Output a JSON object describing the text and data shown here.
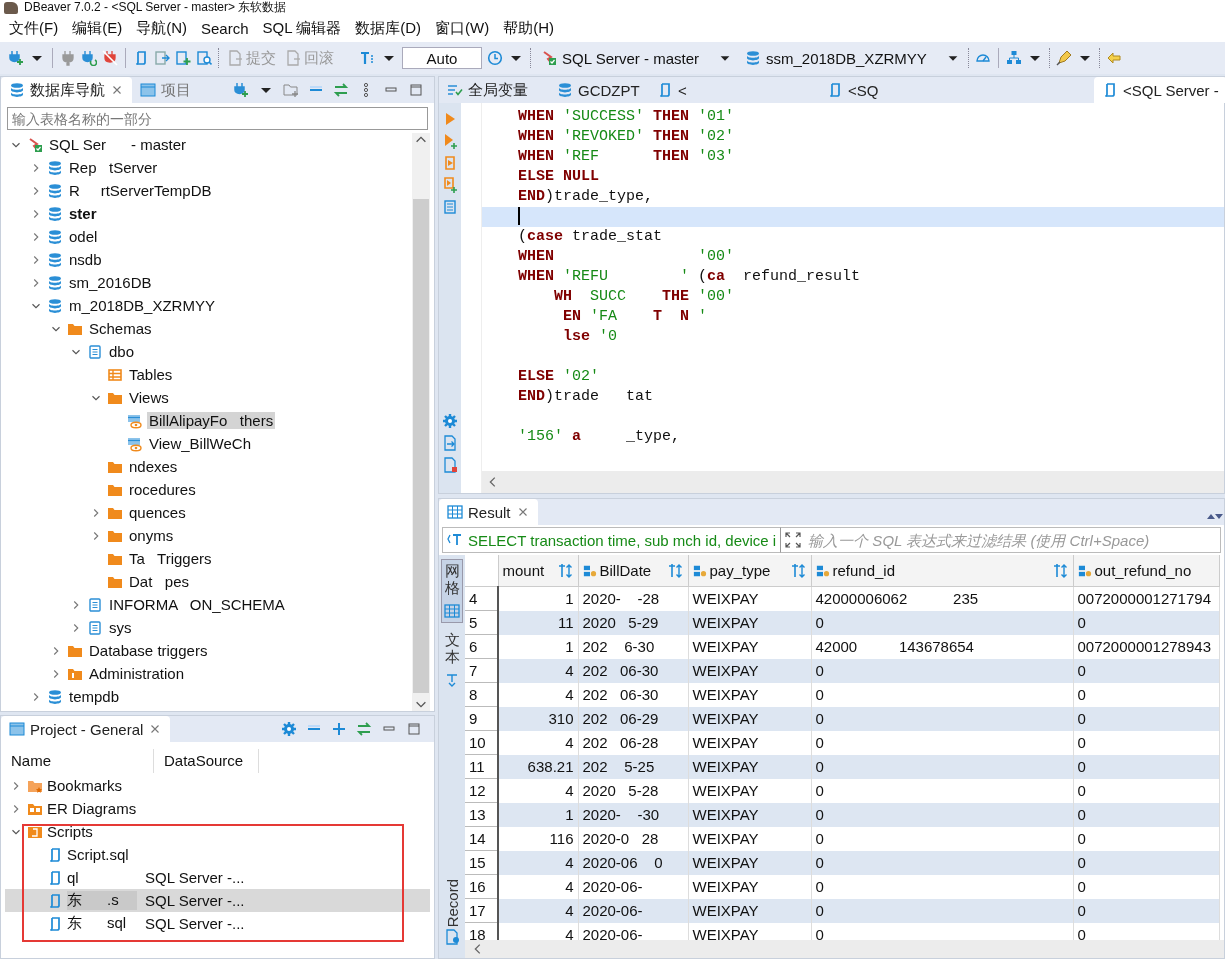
{
  "window": {
    "title": "DBeaver 7.0.2 - <SQL Server - master> 东软数据"
  },
  "menu": [
    "文件(F)",
    "编辑(E)",
    "导航(N)",
    "Search",
    "SQL 编辑器",
    "数据库(D)",
    "窗口(W)",
    "帮助(H)"
  ],
  "toolbar": {
    "commit": "提交",
    "rollback": "回滚",
    "mode": "Auto",
    "connection": "SQL Server - master",
    "database": "ssm_2018DB_XZRMYY"
  },
  "navigator": {
    "tabs": [
      {
        "label": "数据库导航",
        "selected": true
      },
      {
        "label": "项目",
        "selected": false
      }
    ],
    "filter": {
      "placeholder": "输入表格名称的一部分"
    },
    "tree": [
      {
        "label": "SQL Ser      - master",
        "kind": "connection",
        "expanded": true,
        "selected": false,
        "children": [
          {
            "label": "Rep   tServer",
            "kind": "database",
            "expanded": false,
            "selected": false,
            "default": false
          },
          {
            "label": "R     rtServerTempDB",
            "kind": "database",
            "expanded": false,
            "selected": false,
            "default": false
          },
          {
            "label": "ster",
            "kind": "database",
            "expanded": false,
            "selected": false,
            "default": true
          },
          {
            "label": "odel",
            "kind": "database",
            "expanded": false,
            "selected": false,
            "default": false
          },
          {
            "label": "nsdb",
            "kind": "database",
            "expanded": false,
            "selected": false,
            "default": false
          },
          {
            "label": "sm_2016DB",
            "kind": "database",
            "expanded": false,
            "selected": false,
            "default": false
          },
          {
            "label": "m_2018DB_XZRMYY",
            "kind": "database",
            "expanded": true,
            "selected": false,
            "default": false,
            "children": [
              {
                "label": "Schemas",
                "kind": "folder",
                "expanded": true,
                "selected": false,
                "children": [
                  {
                    "label": "dbo",
                    "kind": "schema",
                    "expanded": true,
                    "selected": false,
                    "children": [
                      {
                        "label": "Tables",
                        "kind": "tables",
                        "selected": false
                      },
                      {
                        "label": "Views",
                        "kind": "folder",
                        "expanded": true,
                        "selected": false,
                        "children": [
                          {
                            "label": "BillAlipayFo   thers",
                            "kind": "view",
                            "selected": true
                          },
                          {
                            "label": "View_BillWeCh",
                            "kind": "view",
                            "selected": false
                          }
                        ]
                      },
                      {
                        "label": "ndexes",
                        "kind": "folder",
                        "selected": false
                      },
                      {
                        "label": "rocedures",
                        "kind": "folder",
                        "selected": false
                      },
                      {
                        "label": "quences",
                        "kind": "folder",
                        "expanded": false,
                        "selected": false
                      },
                      {
                        "label": "onyms",
                        "kind": "folder",
                        "expanded": false,
                        "selected": false
                      },
                      {
                        "label": "Ta   Triggers",
                        "kind": "folder",
                        "selected": false
                      },
                      {
                        "label": "Dat   pes",
                        "kind": "folder",
                        "selected": false
                      }
                    ]
                  },
                  {
                    "label": "INFORMA   ON_SCHEMA",
                    "kind": "schema",
                    "expanded": false,
                    "selected": false
                  },
                  {
                    "label": "sys",
                    "kind": "schema",
                    "expanded": false,
                    "selected": false
                  }
                ]
              },
              {
                "label": "Database triggers",
                "kind": "folder",
                "expanded": false,
                "selected": false
              },
              {
                "label": "Administration",
                "kind": "admin",
                "expanded": false,
                "selected": false
              }
            ]
          },
          {
            "label": "tempdb",
            "kind": "database",
            "expanded": false,
            "selected": false,
            "default": false
          }
        ]
      }
    ]
  },
  "project": {
    "tab": "Project - General",
    "columns": [
      "Name",
      "DataSource"
    ],
    "tree": [
      {
        "label": "Bookmarks",
        "kind": "bookmarks",
        "expanded": false,
        "selected": false
      },
      {
        "label": "ER Diagrams",
        "kind": "diagrams",
        "expanded": false,
        "selected": false
      },
      {
        "label": "Scripts",
        "kind": "scripts",
        "expanded": true,
        "selected": false,
        "children": [
          {
            "label": "Script.sql",
            "kind": "script",
            "selected": false
          },
          {
            "label": "ql",
            "kind": "script",
            "selected": false,
            "datasource": "SQL Server -..."
          },
          {
            "label": "东      .s",
            "kind": "script",
            "selected": true,
            "datasource": "SQL Server -..."
          },
          {
            "label": "东      sql",
            "kind": "script",
            "selected": false,
            "datasource": "SQL Server -..."
          }
        ]
      }
    ]
  },
  "editor": {
    "tabs": [
      {
        "label": "全局变量",
        "kind": "variables",
        "selected": false
      },
      {
        "label": "GCDZPT",
        "kind": "database",
        "selected": false
      },
      {
        "label": "<",
        "kind": "script",
        "selected": false
      },
      {
        "label": "<SQ",
        "kind": "script",
        "selected": false
      },
      {
        "label": "<SQL Server -",
        "kind": "script",
        "selected": true
      }
    ],
    "lines": [
      {
        "current": false,
        "tokens": [
          {
            "kind": "keyword",
            "text": "WHEN"
          },
          {
            "kind": "string",
            "text": " 'SUCCESS'"
          },
          {
            "kind": "keyword",
            "text": " THEN"
          },
          {
            "kind": "string",
            "text": " '01'"
          }
        ]
      },
      {
        "current": false,
        "tokens": [
          {
            "kind": "keyword",
            "text": "WHEN"
          },
          {
            "kind": "string",
            "text": " 'REVOKED'"
          },
          {
            "kind": "keyword",
            "text": " THEN"
          },
          {
            "kind": "string",
            "text": " '02'"
          }
        ]
      },
      {
        "current": false,
        "tokens": [
          {
            "kind": "keyword",
            "text": "WHEN"
          },
          {
            "kind": "string",
            "text": " 'REF"
          },
          {
            "kind": "keyword",
            "text": "      THEN"
          },
          {
            "kind": "string",
            "text": " '03'"
          }
        ]
      },
      {
        "current": false,
        "tokens": [
          {
            "kind": "keyword",
            "text": "ELSE NULL"
          }
        ]
      },
      {
        "current": false,
        "tokens": [
          {
            "kind": "keyword",
            "text": "END"
          },
          {
            "kind": "plain",
            "text": ")trade_type,"
          }
        ]
      },
      {
        "current": true
      },
      {
        "current": false,
        "tokens": [
          {
            "kind": "plain",
            "text": "("
          },
          {
            "kind": "keyword",
            "text": "case"
          },
          {
            "kind": "plain",
            "text": " trade_stat"
          }
        ]
      },
      {
        "current": false,
        "tokens": [
          {
            "kind": "keyword",
            "text": "WHEN"
          },
          {
            "kind": "string",
            "text": "                '00'"
          }
        ]
      },
      {
        "current": false,
        "tokens": [
          {
            "kind": "keyword",
            "text": "WHEN"
          },
          {
            "kind": "string",
            "text": " 'REFU        '"
          },
          {
            "kind": "plain",
            "text": " ("
          },
          {
            "kind": "keyword",
            "text": "ca"
          },
          {
            "kind": "plain",
            "text": "  refund_result"
          }
        ]
      },
      {
        "current": false,
        "tokens": [
          {
            "kind": "keyword",
            "text": "    WH"
          },
          {
            "kind": "string",
            "text": "  SUCC"
          },
          {
            "kind": "keyword",
            "text": "    THE"
          },
          {
            "kind": "string",
            "text": " '00'"
          }
        ]
      },
      {
        "current": false,
        "tokens": [
          {
            "kind": "keyword",
            "text": "     EN"
          },
          {
            "kind": "string",
            "text": " 'FA"
          },
          {
            "kind": "keyword",
            "text": "    T  N"
          },
          {
            "kind": "string",
            "text": " '"
          }
        ]
      },
      {
        "current": false,
        "tokens": [
          {
            "kind": "keyword",
            "text": "     lse"
          },
          {
            "kind": "string",
            "text": " '0"
          }
        ]
      },
      {
        "current": false
      },
      {
        "current": false,
        "tokens": [
          {
            "kind": "keyword",
            "text": "ELSE"
          },
          {
            "kind": "string",
            "text": " '02'"
          }
        ]
      },
      {
        "current": false,
        "tokens": [
          {
            "kind": "keyword",
            "text": "END"
          },
          {
            "kind": "plain",
            "text": ")trade   tat"
          }
        ]
      },
      {
        "current": false
      },
      {
        "current": false,
        "tokens": [
          {
            "kind": "string",
            "text": "'156'"
          },
          {
            "kind": "keyword",
            "text": " a"
          },
          {
            "kind": "plain",
            "text": "     _type,"
          }
        ]
      }
    ]
  },
  "result": {
    "tab": "Result",
    "query": "SELECT transaction time, sub mch id, device i",
    "filter": {
      "placeholder": "输入一个 SQL 表达式来过滤结果 (使用 Ctrl+Space)"
    },
    "side_tabs": [
      {
        "label": "网格",
        "selected": true
      },
      {
        "label": "文本",
        "selected": false
      },
      {
        "label": "Record",
        "selected": false
      }
    ],
    "columns": [
      "mount",
      "BillDate",
      "pay_type",
      "refund_id",
      "out_refund_no"
    ],
    "rows": [
      {
        "number": "4",
        "cells": [
          "1",
          "2020-    -28",
          "WEIXPAY",
          "42000006062           235",
          "0072000001271794"
        ]
      },
      {
        "number": "5",
        "cells": [
          "11",
          "2020   5-29",
          "WEIXPAY",
          "0",
          "0"
        ]
      },
      {
        "number": "6",
        "cells": [
          "1",
          "202    6-30",
          "WEIXPAY",
          "42000          143678654",
          "0072000001278943"
        ]
      },
      {
        "number": "7",
        "cells": [
          "4",
          "202   06-30",
          "WEIXPAY",
          "0",
          "0"
        ]
      },
      {
        "number": "8",
        "cells": [
          "4",
          "202   06-30",
          "WEIXPAY",
          "0",
          "0"
        ]
      },
      {
        "number": "9",
        "cells": [
          "310",
          "202   06-29",
          "WEIXPAY",
          "0",
          "0"
        ]
      },
      {
        "number": "10",
        "cells": [
          "4",
          "202   06-28",
          "WEIXPAY",
          "0",
          "0"
        ]
      },
      {
        "number": "11",
        "cells": [
          "638.21",
          "202    5-25",
          "WEIXPAY",
          "0",
          "0"
        ]
      },
      {
        "number": "12",
        "cells": [
          "4",
          "2020   5-28",
          "WEIXPAY",
          "0",
          "0"
        ]
      },
      {
        "number": "13",
        "cells": [
          "1",
          "2020-    -30",
          "WEIXPAY",
          "0",
          "0"
        ]
      },
      {
        "number": "14",
        "cells": [
          "116",
          "2020-0   28",
          "WEIXPAY",
          "0",
          "0"
        ]
      },
      {
        "number": "15",
        "cells": [
          "4",
          "2020-06    0",
          "WEIXPAY",
          "0",
          "0"
        ]
      },
      {
        "number": "16",
        "cells": [
          "4",
          "2020-06-",
          "WEIXPAY",
          "0",
          "0"
        ]
      },
      {
        "number": "17",
        "cells": [
          "4",
          "2020-06-",
          "WEIXPAY",
          "0",
          "0"
        ]
      },
      {
        "number": "18",
        "cells": [
          "4",
          "2020-06-",
          "WEIXPAY",
          "0",
          "0"
        ]
      }
    ]
  }
}
